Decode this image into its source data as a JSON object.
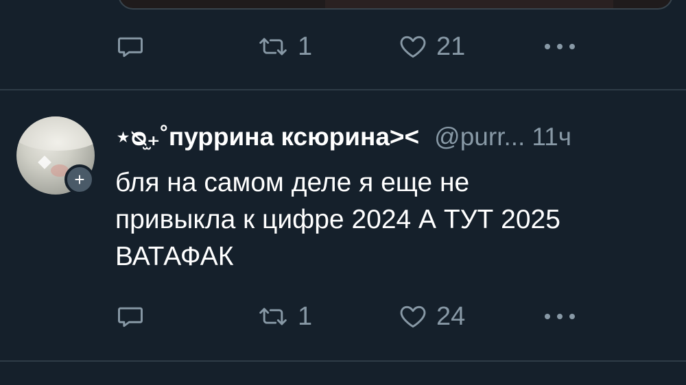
{
  "previous_tweet": {
    "actions": {
      "reply_count": "",
      "retweet_count": "1",
      "like_count": "21"
    }
  },
  "tweet": {
    "author": {
      "display_name": "⋆ᴓ̫₊˚пуррина ксюрина><",
      "handle": "@purr...",
      "avatar_icon": "avatar-image"
    },
    "time": "11ч",
    "text_lines": [
      "бля на самом деле я еще не",
      "привыкла к цифре 2024 А ТУТ 2025",
      "ВАТАФАК"
    ],
    "actions": {
      "reply_count": "",
      "retweet_count": "1",
      "like_count": "24"
    }
  },
  "colors": {
    "background": "#15202b",
    "muted": "#8899a6",
    "divider": "#2f3c47",
    "text": "#ffffff"
  }
}
